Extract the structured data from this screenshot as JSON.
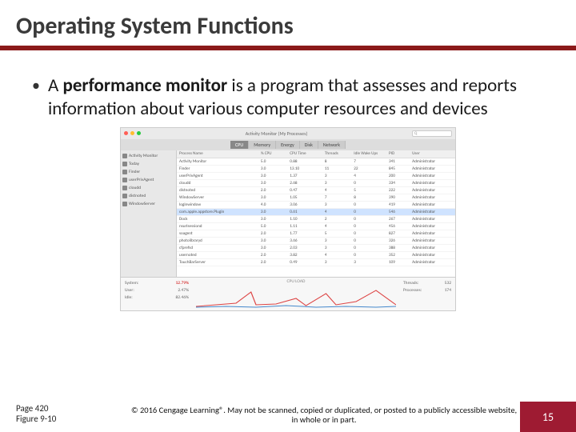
{
  "title": "Operating System Functions",
  "bullet": {
    "prefix": "A ",
    "bold": "performance monitor",
    "rest": " is a program that assesses and reports information about various computer resources and devices"
  },
  "screenshot": {
    "window_title": "Activity Monitor (My Processes)",
    "search_placeholder": "Search",
    "tabs": [
      "CPU",
      "Memory",
      "Energy",
      "Disk",
      "Network"
    ],
    "active_tab": 0,
    "side_items": [
      "Activity Monitor",
      "Today",
      "Finder",
      "userPrivAgent",
      "cloudd",
      "distnoted",
      "WindowServer"
    ],
    "columns": [
      "Process Name",
      "% CPU",
      "CPU Time",
      "Threads",
      "Idle Wake Ups",
      "PID",
      "User"
    ],
    "rows": [
      {
        "name": "Activity Monitor",
        "cpu": "5.0",
        "time": "0.88",
        "th": "8",
        "wk": "7",
        "pid": "341",
        "user": "Administrator"
      },
      {
        "name": "Finder",
        "cpu": "3.0",
        "time": "13.10",
        "th": "11",
        "wk": "22",
        "pid": "845",
        "user": "Administrator"
      },
      {
        "name": "userPrivAgent",
        "cpu": "3.0",
        "time": "1.37",
        "th": "3",
        "wk": "4",
        "pid": "200",
        "user": "Administrator"
      },
      {
        "name": "cloudd",
        "cpu": "3.0",
        "time": "2.68",
        "th": "3",
        "wk": "0",
        "pid": "334",
        "user": "Administrator"
      },
      {
        "name": "distnoted",
        "cpu": "2.0",
        "time": "0.47",
        "th": "4",
        "wk": "5",
        "pid": "222",
        "user": "Administrator"
      },
      {
        "name": "WindowServer",
        "cpu": "3.0",
        "time": "1.05",
        "th": "7",
        "wk": "8",
        "pid": "390",
        "user": "Administrator"
      },
      {
        "name": "loginwindow",
        "cpu": "4.0",
        "time": "3.06",
        "th": "3",
        "wk": "0",
        "pid": "419",
        "user": "Administrator"
      },
      {
        "name": "com.apple.appstore.Plugin",
        "cpu": "3.0",
        "time": "0.61",
        "th": "4",
        "wk": "0",
        "pid": "546",
        "user": "Administrator"
      },
      {
        "name": "Dock",
        "cpu": "3.0",
        "time": "1.10",
        "th": "2",
        "wk": "0",
        "pid": "267",
        "user": "Administrator"
      },
      {
        "name": "nsurlsessiond",
        "cpu": "5.0",
        "time": "1.11",
        "th": "4",
        "wk": "0",
        "pid": "456",
        "user": "Administrator"
      },
      {
        "name": "soagent",
        "cpu": "2.0",
        "time": "1.77",
        "th": "5",
        "wk": "0",
        "pid": "827",
        "user": "Administrator"
      },
      {
        "name": "photolibraryd",
        "cpu": "3.0",
        "time": "3.66",
        "th": "3",
        "wk": "0",
        "pid": "326",
        "user": "Administrator"
      },
      {
        "name": "cfprefsd",
        "cpu": "3.0",
        "time": "2.03",
        "th": "3",
        "wk": "0",
        "pid": "388",
        "user": "Administrator"
      },
      {
        "name": "usernoted",
        "cpu": "2.0",
        "time": "3.82",
        "th": "4",
        "wk": "0",
        "pid": "352",
        "user": "Administrator"
      },
      {
        "name": "TouchBarServer",
        "cpu": "2.0",
        "time": "0.49",
        "th": "3",
        "wk": "3",
        "pid": "109",
        "user": "Administrator"
      }
    ],
    "summary": {
      "system_label": "System:",
      "system_val": "12.79%",
      "user_label": "User:",
      "user_val": "2.47%",
      "idle_label": "Idle:",
      "idle_val": "82.46%",
      "cpu_load_label": "CPU LOAD",
      "threads_label": "Threads:",
      "threads_val": "532",
      "processes_label": "Processes:",
      "processes_val": "174"
    }
  },
  "footer": {
    "page": "Page 420",
    "figure": "Figure 9-10",
    "copyright": "© 2016 Cengage Learning®. May not be scanned, copied or duplicated, or posted to a publicly accessible website, in whole or in part.",
    "slide_number": "15"
  }
}
